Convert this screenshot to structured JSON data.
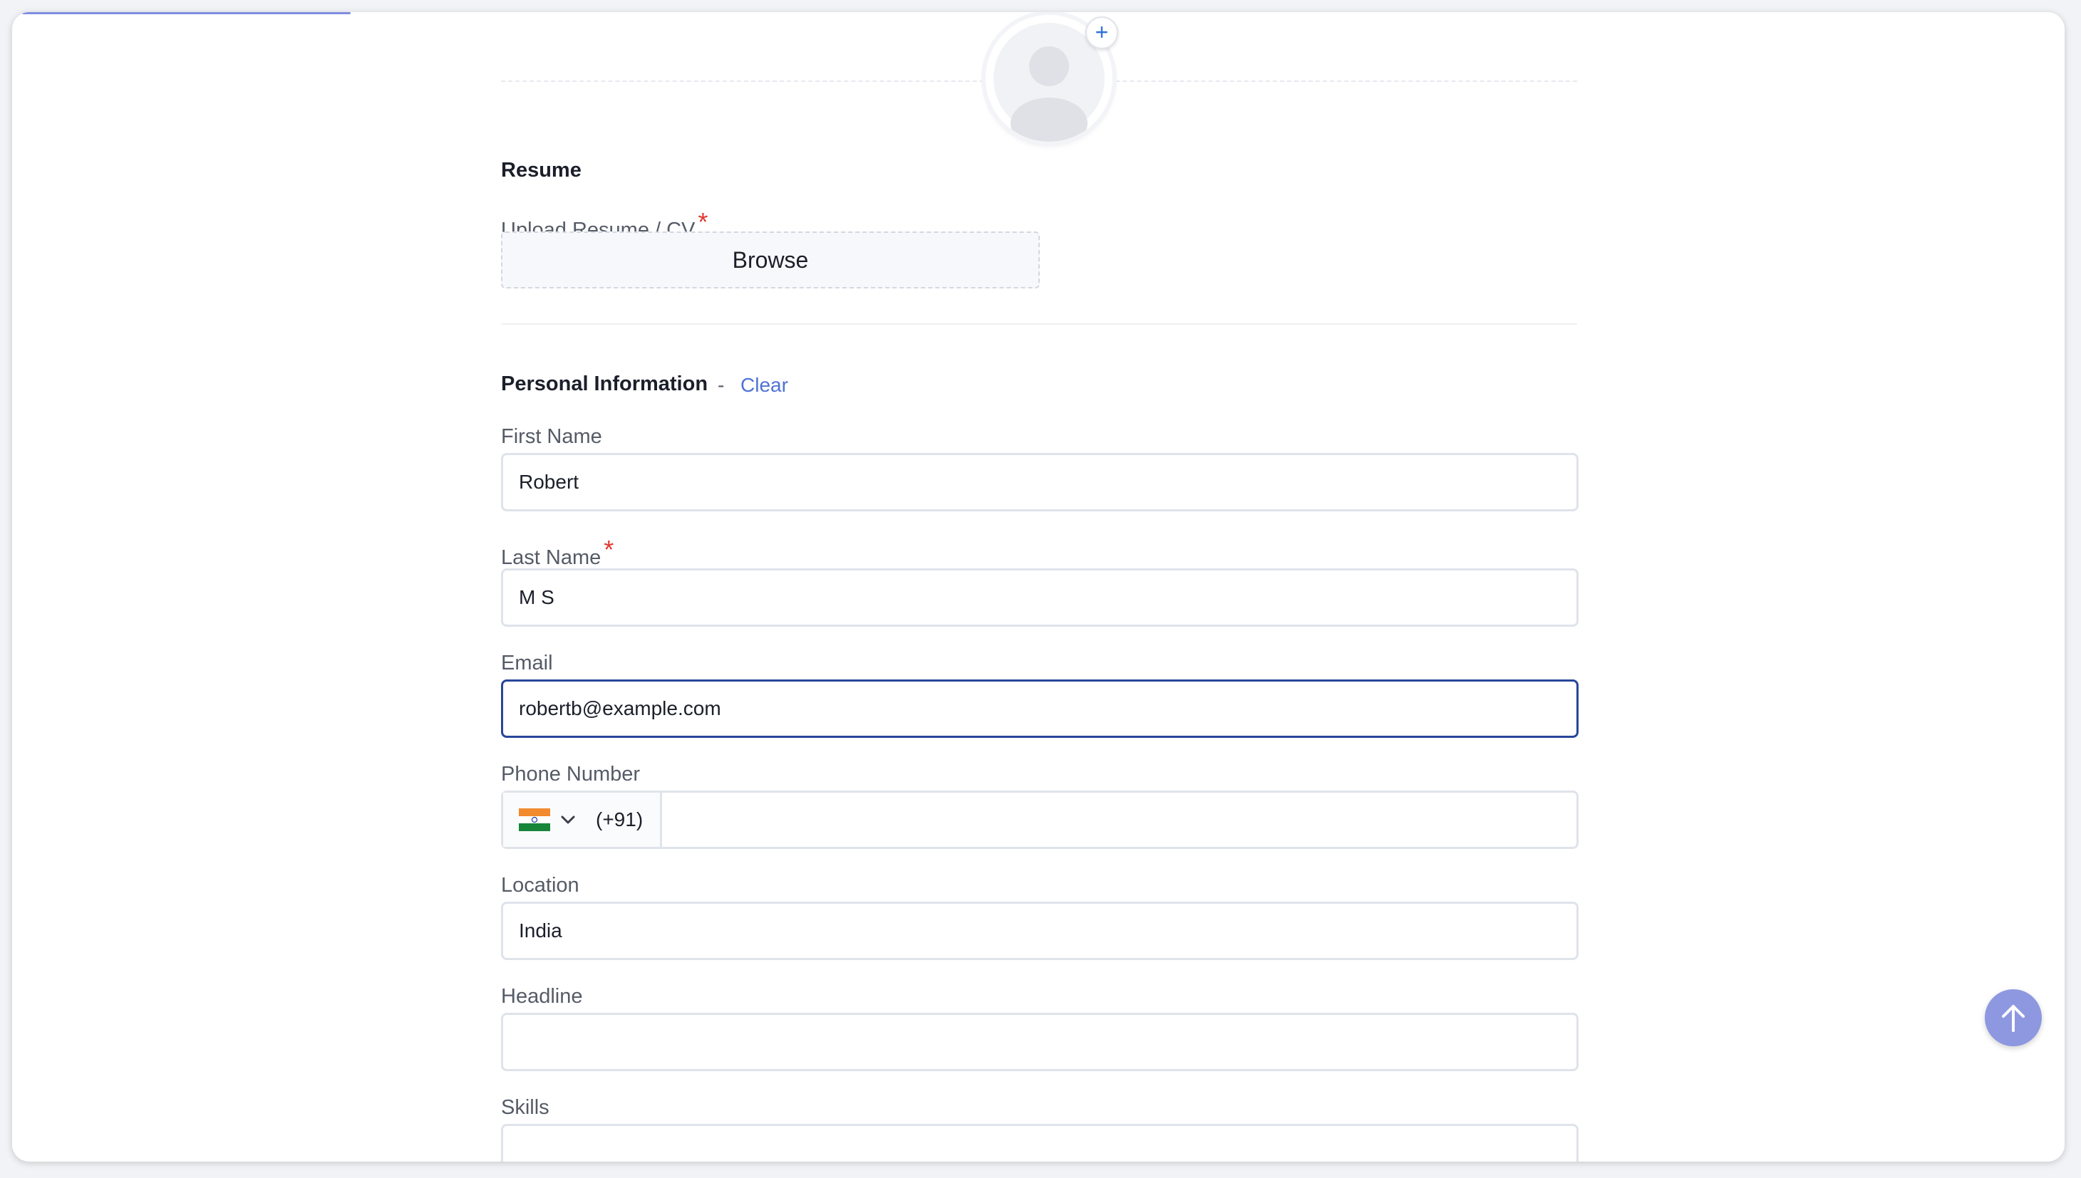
{
  "upload_progress": 0.16,
  "profile": {
    "add_photo_symbol": "+"
  },
  "resume": {
    "title": "Resume",
    "upload_label": "Upload Resume / CV",
    "required_mark": "*",
    "browse_label": "Browse"
  },
  "personal": {
    "title": "Personal Information",
    "separator": "-",
    "clear_label": "Clear",
    "fields": {
      "first_name": {
        "label": "First Name",
        "value": "Robert"
      },
      "last_name": {
        "label": "Last Name",
        "value": "M S",
        "required_mark": "*"
      },
      "email": {
        "label": "Email",
        "value": "robertb@example.com"
      },
      "phone": {
        "label": "Phone Number",
        "country_flag": "india-flag-icon",
        "dial_code": "(+91)",
        "value": ""
      },
      "location": {
        "label": "Location",
        "value": "India"
      },
      "headline": {
        "label": "Headline",
        "value": ""
      },
      "skills": {
        "label": "Skills",
        "value": ""
      }
    }
  },
  "icons": {
    "avatar": "avatar-placeholder-icon",
    "add": "plus-icon",
    "chevron": "chevron-down-icon",
    "scroll_top": "arrow-up-icon"
  },
  "colors": {
    "accent": "#4f73d4",
    "focus_border": "#27469b",
    "required": "#e0392f",
    "scroll_button": "#8d98e0"
  }
}
